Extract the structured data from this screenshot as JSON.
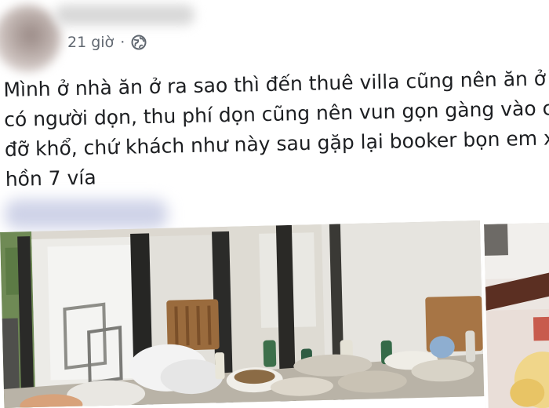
{
  "post": {
    "time": "21 giờ",
    "separator": "·",
    "privacy_icon": "globe-icon",
    "text_lines": [
      "Mình ở nhà ăn ở ra sao thì đến thuê villa cũng nên ăn ở",
      "có người dọn, thu phí dọn cũng nên vun gọn gàng vào c",
      "đỡ khổ, chứ khách như này sau gặp lại booker bọn em x",
      "hồn 7 vía"
    ]
  },
  "colors": {
    "meta_text": "#606770",
    "body_text": "#1c1e21",
    "card_bg": "#ffffff"
  }
}
